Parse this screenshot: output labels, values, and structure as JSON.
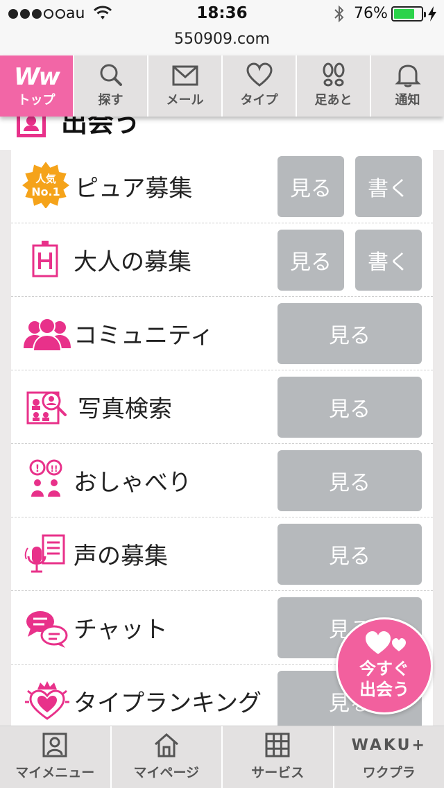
{
  "status_bar": {
    "carrier": "au",
    "time": "18:36",
    "battery_percent": "76%",
    "battery_level": 0.76,
    "signal_bars_filled": 3
  },
  "url_bar": {
    "url": "550909.com"
  },
  "top_nav": {
    "items": [
      {
        "label": "トップ",
        "icon": "ww-logo-icon",
        "active": true
      },
      {
        "label": "探す",
        "icon": "search-icon"
      },
      {
        "label": "メール",
        "icon": "mail-icon"
      },
      {
        "label": "タイプ",
        "icon": "heart-icon"
      },
      {
        "label": "足あと",
        "icon": "footprints-icon"
      },
      {
        "label": "通知",
        "icon": "bell-icon"
      }
    ],
    "logo_text": "Ww"
  },
  "section": {
    "title": "出会う",
    "icon": "profile-frame-icon"
  },
  "list": {
    "rows": [
      {
        "label": "ピュア募集",
        "icon": "popular-no1-badge-icon",
        "badge_line1": "人気",
        "badge_line2": "No.1",
        "view": "見る",
        "write": "書く"
      },
      {
        "label": "大人の募集",
        "icon": "hotel-h-icon",
        "view": "見る",
        "write": "書く"
      },
      {
        "label": "コミュニティ",
        "icon": "people-group-icon",
        "view": "見る"
      },
      {
        "label": "写真検索",
        "icon": "photo-search-icon",
        "view": "見る"
      },
      {
        "label": "おしゃべり",
        "icon": "chat-people-icon",
        "view": "見る"
      },
      {
        "label": "声の募集",
        "icon": "voice-mic-icon",
        "view": "見る"
      },
      {
        "label": "チャット",
        "icon": "chat-bubbles-icon",
        "view": "見る"
      },
      {
        "label": "タイプランキング",
        "icon": "crown-heart-icon",
        "view": "見る"
      }
    ]
  },
  "float_button": {
    "line1": "今すぐ",
    "line2": "出会う",
    "icon": "hearts-icon"
  },
  "bottom_nav": {
    "items": [
      {
        "label": "マイメニュー",
        "icon": "profile-card-icon"
      },
      {
        "label": "マイページ",
        "icon": "home-icon"
      },
      {
        "label": "サービス",
        "icon": "grid-icon"
      },
      {
        "label": "ワクプラ",
        "icon": "waku-plus-logo",
        "logo_text": "WAKU+"
      }
    ]
  },
  "colors": {
    "accent_pink": "#f266a6",
    "icon_pink": "#e8318a",
    "button_gray": "#b6b9bc",
    "badge_orange": "#f5a31a"
  }
}
